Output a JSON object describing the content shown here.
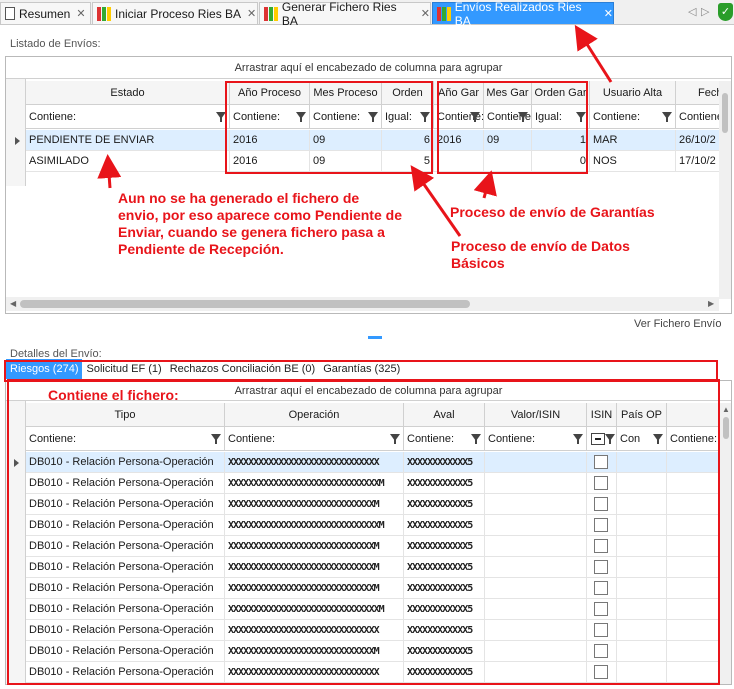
{
  "tabs": [
    {
      "label": "Resumen",
      "icon": "document-icon",
      "close": "✕"
    },
    {
      "label": "Iniciar Proceso Ries BA",
      "icon": "bar-chart-icon",
      "close": "✕"
    },
    {
      "label": "Generar Fichero Ries BA",
      "icon": "bar-chart-icon",
      "close": "✕"
    },
    {
      "label": "Envíos Realizados Ries BA",
      "icon": "bar-chart-icon",
      "close": "✕"
    }
  ],
  "tab_controls": {
    "prev": "◁",
    "next": "▷"
  },
  "listado": {
    "title": "Listado de Envíos:",
    "group_hint": "Arrastrar aquí el encabezado de columna para agrupar",
    "columns": [
      "Estado",
      "Año Proceso",
      "Mes Proceso",
      "Orden",
      "Año Gar",
      "Mes Gar",
      "Orden Gar",
      "Usuario Alta",
      "Fech"
    ],
    "filters": [
      "Contiene:",
      "Contiene:",
      "Contiene:",
      "Igual:",
      "Contiene:",
      "Contiene:",
      "Igual:",
      "Contiene:",
      "Contiene:"
    ],
    "rows": [
      [
        "PENDIENTE DE ENVIAR",
        "2016",
        "09",
        "6",
        "2016",
        "09",
        "1",
        "MAR",
        "26/10/2"
      ],
      [
        "ASIMILADO",
        "2016",
        "09",
        "5",
        "",
        "",
        "0",
        "NOS",
        "17/10/2"
      ]
    ],
    "ver_fichero": "Ver Fichero Envío"
  },
  "detalles": {
    "title": "Detalles del Envío:",
    "tabs": [
      "Riesgos (274)",
      "Solicitud EF (1)",
      "Rechazos Conciliación BE (0)",
      "Garantías (325)"
    ],
    "group_hint": "Arrastrar aquí el encabezado de columna para agrupar",
    "columns": [
      "Tipo",
      "Operación",
      "Aval",
      "Valor/ISIN",
      "ISIN",
      "País OP",
      ""
    ],
    "filters": [
      "Contiene:",
      "Contiene:",
      "Contiene:",
      "Contiene:",
      "",
      "Con",
      "Contiene:"
    ],
    "rows": [
      {
        "tipo": "DB010 - Relación Persona-Operación",
        "op": "XXXXXXXXXXXXXXXXXXXXXXXXXXXXXX",
        "aval": "XXXXXXXXXXXX5"
      },
      {
        "tipo": "DB010 - Relación Persona-Operación",
        "op": "XXXXXXXXXXXXXXXXXXXXXXXXXXXXXXM",
        "aval": "XXXXXXXXXXXX5"
      },
      {
        "tipo": "DB010 - Relación Persona-Operación",
        "op": "XXXXXXXXXXXXXXXXXXXXXXXXXXXXXM",
        "aval": "XXXXXXXXXXXX5"
      },
      {
        "tipo": "DB010 - Relación Persona-Operación",
        "op": "XXXXXXXXXXXXXXXXXXXXXXXXXXXXXXM",
        "aval": "XXXXXXXXXXXX5"
      },
      {
        "tipo": "DB010 - Relación Persona-Operación",
        "op": "XXXXXXXXXXXXXXXXXXXXXXXXXXXXXM",
        "aval": "XXXXXXXXXXXX5"
      },
      {
        "tipo": "DB010 - Relación Persona-Operación",
        "op": "XXXXXXXXXXXXXXXXXXXXXXXXXXXXXM",
        "aval": "XXXXXXXXXXXX5"
      },
      {
        "tipo": "DB010 - Relación Persona-Operación",
        "op": "XXXXXXXXXXXXXXXXXXXXXXXXXXXXXM",
        "aval": "XXXXXXXXXXXX5"
      },
      {
        "tipo": "DB010 - Relación Persona-Operación",
        "op": "XXXXXXXXXXXXXXXXXXXXXXXXXXXXXXM",
        "aval": "XXXXXXXXXXXX5"
      },
      {
        "tipo": "DB010 - Relación Persona-Operación",
        "op": "XXXXXXXXXXXXXXXXXXXXXXXXXXXXXX",
        "aval": "XXXXXXXXXXXX5"
      },
      {
        "tipo": "DB010 - Relación Persona-Operación",
        "op": "XXXXXXXXXXXXXXXXXXXXXXXXXXXXXM",
        "aval": "XXXXXXXXXXXX5"
      },
      {
        "tipo": "DB010 - Relación Persona-Operación",
        "op": "XXXXXXXXXXXXXXXXXXXXXXXXXXXXXX",
        "aval": "XXXXXXXXXXXX5"
      }
    ]
  },
  "annotations": {
    "note_pendiente": "Aun no se ha generado el fichero de envio, por eso aparece como Pendiente de Enviar, cuando se genera fichero pasa a Pendiente de Recepción.",
    "note_garantias": "Proceso de envío de Garantías",
    "note_basicos": "Proceso de envío de Datos Básicos",
    "note_fichero": "Contiene el fichero:",
    "color": "#e8141a"
  }
}
